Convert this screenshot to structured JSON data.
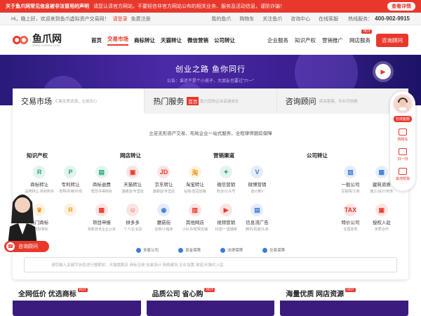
{
  "notice": {
    "title": "关于鱼爪网常见信息被非法冒用的声明",
    "message": "请您认清官方网站，不要轻信非官方网站公布的相关业务、服务及活动信息，谨防诈骗！",
    "button": "查看详情"
  },
  "topbar": {
    "greeting": "Hi，晚上好，欢迎来到鱼爪虚拟资产交易网！",
    "login": "请登录",
    "register": "免费注册",
    "links": [
      "我的鱼爪",
      "购物车",
      "关注鱼爪",
      "咨询中心",
      "在线客服"
    ],
    "hotline_label": "热线服务：",
    "hotline": "400-902-9915"
  },
  "header": {
    "logo_name": "鱼爪网",
    "logo_domain": "WWW.YUZHUA.COM",
    "nav": [
      "首页",
      "交易市场",
      "商标转让",
      "天猫转让",
      "微信营销",
      "公司转让"
    ],
    "nav2": [
      "企业服务",
      "知识产权",
      "营销推广",
      "网店服务"
    ],
    "hot_badge": "HOT",
    "consult_button": "咨询顾问"
  },
  "banner": {
    "headline": "创业之路 鱼你同行",
    "subline": "公告：谁还不是个小孩子，大朋友也要过\"六一\""
  },
  "tabs": [
    {
      "title": "交易市场",
      "highlight": "",
      "sub": "汇集优质资源，交易安心"
    },
    {
      "title": "热门服务",
      "highlight": "首页",
      "sub": "助力您的企业高速成长"
    },
    {
      "title": "咨询顾问",
      "highlight": "",
      "sub": "资深客服，专业可信赖"
    }
  ],
  "promo": "立足无形资产交易、布局企业一站式服务，全程律师跟踪保障",
  "columns": [
    {
      "title": "知识产权",
      "items": [
        {
          "name": "商标转让",
          "desc": "品牌转让·商标购买",
          "icon": "R",
          "color": "#2aa876"
        },
        {
          "name": "专利转让",
          "desc": "发明/实用/外观",
          "icon": "P",
          "color": "#2aa876"
        },
        {
          "name": "商标退费",
          "desc": "帮您寻得商标",
          "icon": "▤",
          "color": "#2aa876"
        },
        {
          "name": "热门商标",
          "desc": "精选好商标",
          "icon": "♛",
          "color": "#f39b1e"
        },
        {
          "name": "",
          "desc": "",
          "icon": "R",
          "color": "#f39b1e"
        },
        {
          "name": "项目申报",
          "desc": "高新技术企业认定",
          "icon": "▦",
          "color": "#e8382c"
        }
      ]
    },
    {
      "title": "网店转让",
      "items": [
        {
          "name": "天猫转让",
          "desc": "旗舰店/专营店",
          "icon": "▣",
          "color": "#e8382c"
        },
        {
          "name": "京东转让",
          "desc": "旗舰店/专营店",
          "icon": "JD",
          "color": "#e8382c"
        },
        {
          "name": "淘宝转让",
          "desc": "钻级/皇冠店铺",
          "icon": "淘",
          "color": "#f39b1e"
        },
        {
          "name": "拼多多",
          "desc": "个人/企业店",
          "icon": "☺",
          "color": "#e8382c"
        },
        {
          "name": "蘑菇街",
          "desc": "全新/小程序",
          "icon": "◉",
          "color": "#3b7bd8"
        },
        {
          "name": "其他网店",
          "desc": "小红书/有赞店铺",
          "icon": "▥",
          "color": "#e8382c"
        }
      ]
    },
    {
      "title": "营销渠道",
      "items": [
        {
          "name": "微信营销",
          "desc": "粉丝/公众号",
          "icon": "✦",
          "color": "#2aa876"
        },
        {
          "name": "微博营销",
          "desc": "蓝V/黄V",
          "icon": "V",
          "color": "#3b7bd8"
        },
        {
          "name": "",
          "desc": "",
          "icon": "",
          "color": "#fff"
        },
        {
          "name": "视频营销",
          "desc": "抖音/一直播等",
          "icon": "▶",
          "color": "#e8382c"
        },
        {
          "name": "信息流广告",
          "desc": "腾讯/百度/头条",
          "icon": "▤",
          "color": "#3b7bd8"
        },
        {
          "name": "",
          "desc": "",
          "icon": "",
          "color": "#fff"
        }
      ]
    },
    {
      "title": "公司转让",
      "items": [
        {
          "name": "",
          "desc": "",
          "icon": "",
          "color": "#fff"
        },
        {
          "name": "一般公司",
          "desc": "互联网/工商",
          "icon": "▥",
          "color": "#3b7bd8"
        },
        {
          "name": "建筑资质",
          "desc": "施工/设计/劳务",
          "icon": "▦",
          "color": "#3b7bd8"
        },
        {
          "name": "",
          "desc": "",
          "icon": "",
          "color": "#fff"
        },
        {
          "name": "特价公司",
          "desc": "全国各地",
          "icon": "TAX",
          "color": "#e8382c"
        },
        {
          "name": "授权入驻",
          "desc": "资质合作",
          "icon": "▣",
          "color": "#e8382c"
        }
      ]
    }
  ],
  "guarantees": [
    "多家公司",
    "资金保障",
    "法律保障",
    "交易保障"
  ],
  "search_placeholder": "请您输入关键字信息进行搜索如：天猫旗舰店   商标注册   包装设计   网络建设   企业设置   淘宝/天猫代入驻",
  "cards": [
    {
      "title": "全网低价 优选商标",
      "hot": "HOT"
    },
    {
      "title": "品质公司 省心购",
      "hot": "HOT"
    },
    {
      "title": "海量优质 网店资源",
      "hot": "HOT"
    }
  ],
  "side": {
    "online": "在线客服",
    "items": [
      "购物车",
      "扫一扫",
      "其他帮我"
    ]
  },
  "chat": "咨询顾问"
}
